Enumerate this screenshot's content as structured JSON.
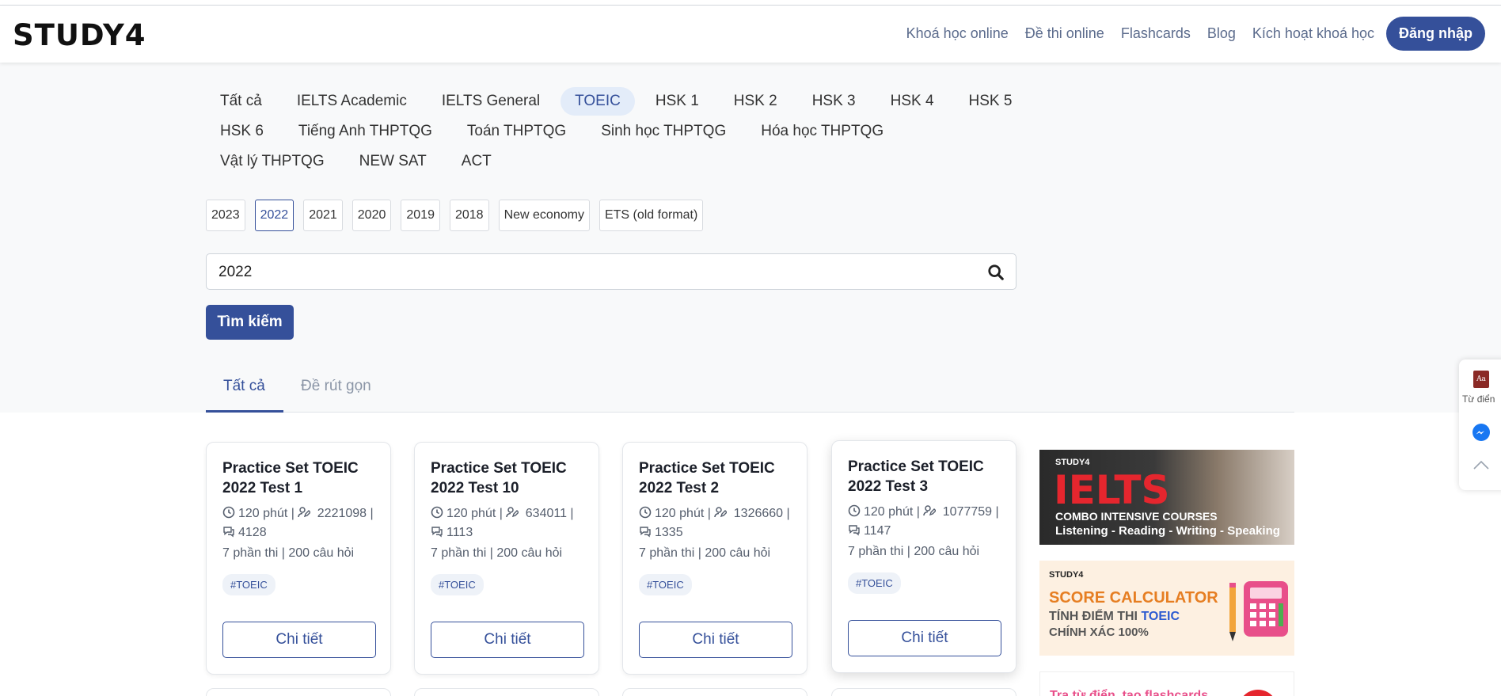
{
  "brand": {
    "logo": "STUDY4"
  },
  "nav": {
    "links": [
      "Khoá học online",
      "Đề thi online",
      "Flashcards",
      "Blog",
      "Kích hoạt khoá học"
    ],
    "login": "Đăng nhập"
  },
  "categories": {
    "row1": [
      "Tất cả",
      "IELTS Academic",
      "IELTS General",
      "TOEIC",
      "HSK 1",
      "HSK 2",
      "HSK 3",
      "HSK 4",
      "HSK 5"
    ],
    "row2": [
      "HSK 6",
      "Tiếng Anh THPTQG",
      "Toán THPTQG",
      "Sinh học THPTQG",
      "Hóa học THPTQG"
    ],
    "row3": [
      "Vật lý THPTQG",
      "NEW SAT",
      "ACT"
    ],
    "active": "TOEIC"
  },
  "years": {
    "items": [
      "2023",
      "2022",
      "2021",
      "2020",
      "2019",
      "2018",
      "New economy",
      "ETS (old format)"
    ],
    "active": "2022"
  },
  "search": {
    "value": "2022",
    "button": "Tìm kiếm",
    "icon": "search-icon"
  },
  "tabs": {
    "items": [
      "Tất cả",
      "Đề rút gọn"
    ],
    "active": "Tất cả"
  },
  "cards": [
    {
      "title": "Practice Set TOEIC 2022 Test 1",
      "duration": "120 phút",
      "users": "2221098",
      "comments": "4128",
      "info": "7 phần thi | 200 câu hỏi",
      "tag": "#TOEIC",
      "button": "Chi tiết"
    },
    {
      "title": "Practice Set TOEIC 2022 Test 10",
      "duration": "120 phút",
      "users": "634011",
      "comments": "1113",
      "info": "7 phần thi | 200 câu hỏi",
      "tag": "#TOEIC",
      "button": "Chi tiết"
    },
    {
      "title": "Practice Set TOEIC 2022 Test 2",
      "duration": "120 phút",
      "users": "1326660",
      "comments": "1335",
      "info": "7 phần thi | 200 câu hỏi",
      "tag": "#TOEIC",
      "button": "Chi tiết"
    },
    {
      "title": "Practice Set TOEIC 2022 Test 3",
      "duration": "120 phút",
      "users": "1077759",
      "comments": "1147",
      "info": "7 phần thi | 200 câu hỏi",
      "tag": "#TOEIC",
      "button": "Chi tiết"
    }
  ],
  "ads": {
    "ielts": {
      "brand": "STUDY4",
      "title": "IELTS",
      "line1": "COMBO INTENSIVE COURSES",
      "line2": "Listening - Reading - Writing - Speaking"
    },
    "score": {
      "brand": "STUDY4",
      "title": "SCORE CALCULATOR",
      "line1_pre": "TÍNH ĐIỂM THI ",
      "line1_hl": "TOEIC",
      "line2": "CHÍNH XÁC 100%"
    },
    "dict": {
      "text": "Tra từ điển, tạo flashcards"
    }
  },
  "side": {
    "dict_label": "Từ điển",
    "dict_glyph": "Aa"
  },
  "colors": {
    "primary": "#35509a",
    "accent_red": "#e5262e",
    "accent_orange": "#e67e22"
  }
}
